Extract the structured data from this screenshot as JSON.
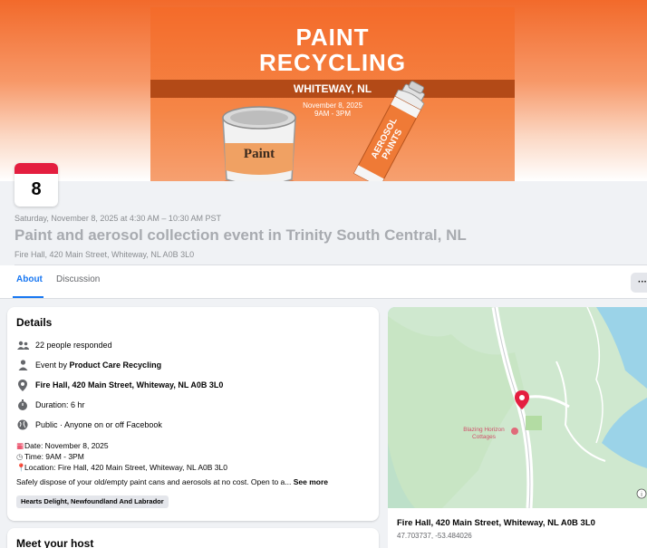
{
  "poster": {
    "title_line1": "PAINT",
    "title_line2": "RECYCLING",
    "location": "WHITEWAY, NL",
    "date_line": "November 8, 2025",
    "time_line": "9AM - 3PM",
    "can_label": "Paint",
    "spray_label_line1": "AEROSOL",
    "spray_label_line2": "PAINTS"
  },
  "colors": {
    "accent_orange": "#f26a2b",
    "calendar_red": "#e41e3f",
    "link_blue": "#1877f2"
  },
  "date_card": {
    "day": "8"
  },
  "header": {
    "datetime": "Saturday, November 8, 2025 at 4:30 AM – 10:30 AM PST",
    "title": "Paint and aerosol collection event in Trinity South Central, NL",
    "location": "Fire Hall, 420 Main Street, Whiteway, NL A0B 3L0"
  },
  "tabs": [
    {
      "label": "About",
      "active": true
    },
    {
      "label": "Discussion",
      "active": false
    }
  ],
  "more_button": "···",
  "details": {
    "heading": "Details",
    "responded": "22 people responded",
    "event_by_prefix": "Event by ",
    "event_by_name": "Product Care Recycling",
    "location": "Fire Hall, 420 Main Street, Whiteway, NL A0B 3L0",
    "duration": "Duration: 6 hr",
    "privacy": "Public · Anyone on or off Facebook",
    "desc_date": "Date: November 8, 2025",
    "desc_time": "Time: 9AM - 3PM",
    "desc_location": "Location: Fire Hall, 420 Main Street, Whiteway, NL A0B 3L0",
    "desc_text": "Safely dispose of your old/empty paint cans and aerosols at no cost. Open to a...",
    "see_more": "See more",
    "chip": "Hearts Delight, Newfoundland And Labrador"
  },
  "host": {
    "heading": "Meet your host"
  },
  "map": {
    "place_label_line1": "Blazing Horizon",
    "place_label_line2": "Cottages",
    "address": "Fire Hall, 420 Main Street, Whiteway, NL A0B 3L0",
    "coords": "47.703737, -53.484026",
    "info_icon": "info-icon"
  }
}
